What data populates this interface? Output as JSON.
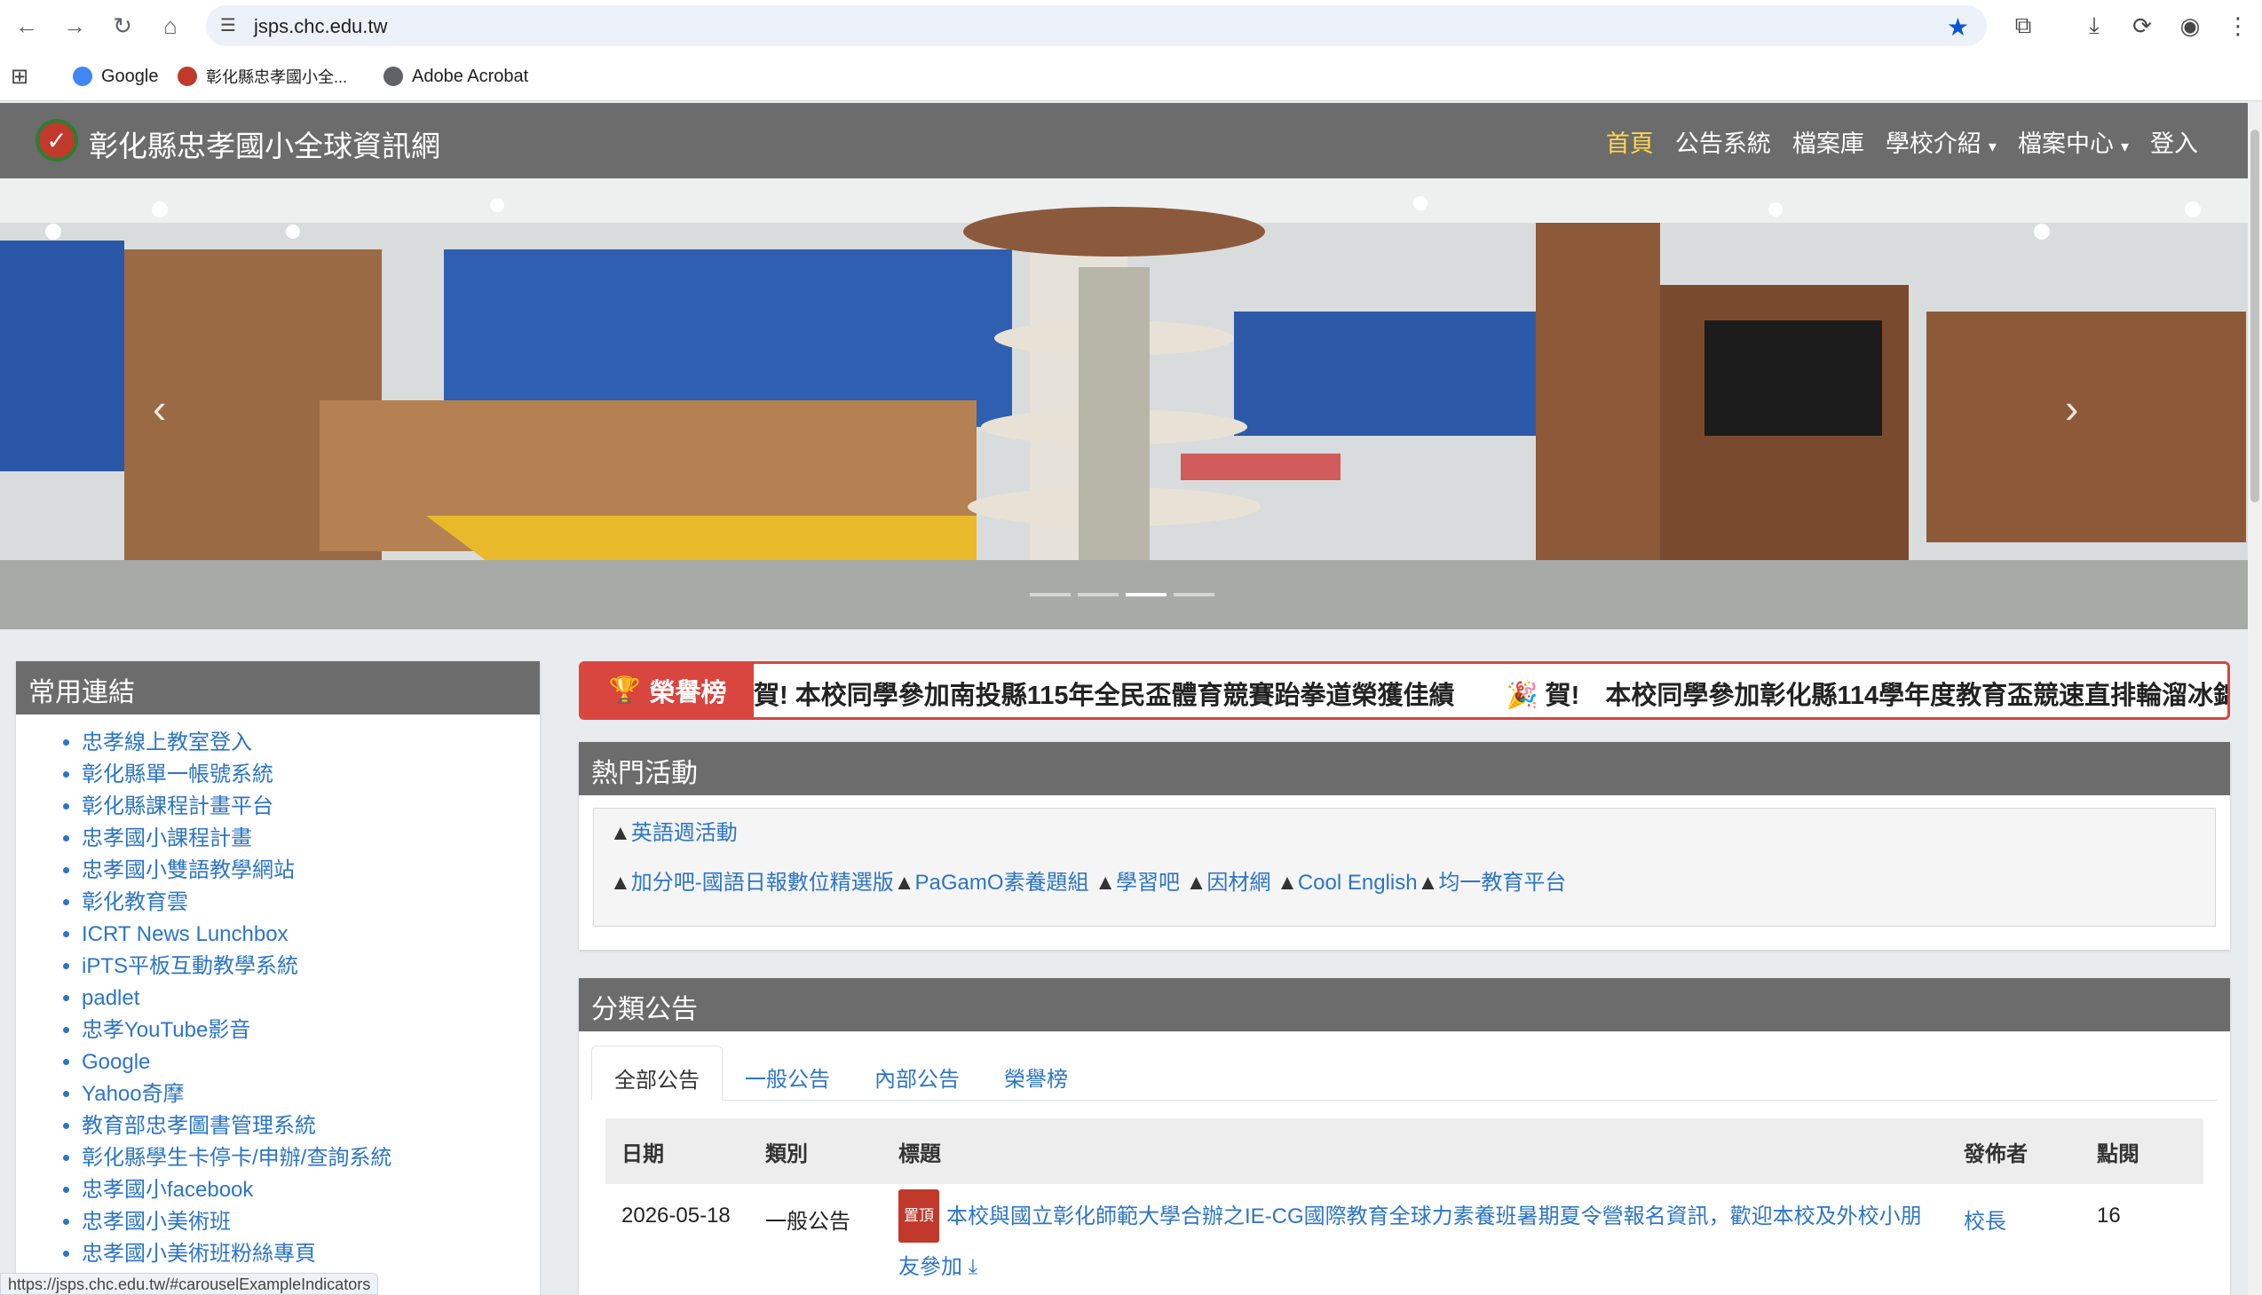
{
  "browser": {
    "url": "jsps.chc.edu.tw",
    "bookmarks": [
      "Google",
      "彰化縣忠孝國小全...",
      "Adobe Acrobat"
    ],
    "status_url": "https://jsps.chc.edu.tw/#carouselExampleIndicators"
  },
  "header": {
    "site_title": "彰化縣忠孝國小全球資訊網",
    "nav": [
      "首頁",
      "公告系統",
      "檔案庫",
      "學校介紹",
      "檔案中心",
      "登入"
    ]
  },
  "sidebar": {
    "title": "常用連結",
    "links": [
      "忠孝線上教室登入",
      "彰化縣單一帳號系統",
      "彰化縣課程計畫平台",
      "忠孝國小課程計畫",
      "忠孝國小雙語教學網站",
      "彰化教育雲",
      "ICRT News Lunchbox",
      "iPTS平板互動教學系統",
      "padlet",
      "忠孝YouTube影音",
      "Google",
      "Yahoo奇摩",
      "教育部忠孝圖書管理系統",
      "彰化縣學生卡停卡/申辦/查詢系統",
      "忠孝國小facebook",
      "忠孝國小美術班",
      "忠孝國小美術班粉絲專頁"
    ]
  },
  "ticker": {
    "badge": "榮譽榜",
    "text": "賀! 本校同學參加南投縣115年全民盃體育競賽跆拳道榮獲佳績　　🎉 賀!　本校同學參加彰化縣114學年度教育盃競速直排輪溜冰錦"
  },
  "hot": {
    "title": "熱門活動",
    "row1": [
      "英語週活動"
    ],
    "row2": [
      "加分吧-國語日報數位精選版",
      "PaGamO素養題組",
      "學習吧",
      "因材網",
      "Cool English",
      "均一教育平台"
    ]
  },
  "announcements": {
    "title": "分類公告",
    "tabs": [
      "全部公告",
      "一般公告",
      "內部公告",
      "榮譽榜"
    ],
    "columns": [
      "日期",
      "類別",
      "標題",
      "發佈者",
      "點閱"
    ],
    "rows": [
      {
        "date": "2026-05-18",
        "type": "一般公告",
        "pin": "置頂",
        "title_line1": "本校與國立彰化師範大學合辦之IE-CG國際教育全球力素養班暑期夏令營報名資訊，歡迎本校及外校小朋",
        "title_line2": "友參加",
        "author": "校長",
        "hits": "16"
      }
    ]
  },
  "colors": {
    "header_bg": "#6c6c6c",
    "link": "#2c75c8",
    "active_nav": "#ffd54f",
    "ticker_red": "#d9453f"
  }
}
